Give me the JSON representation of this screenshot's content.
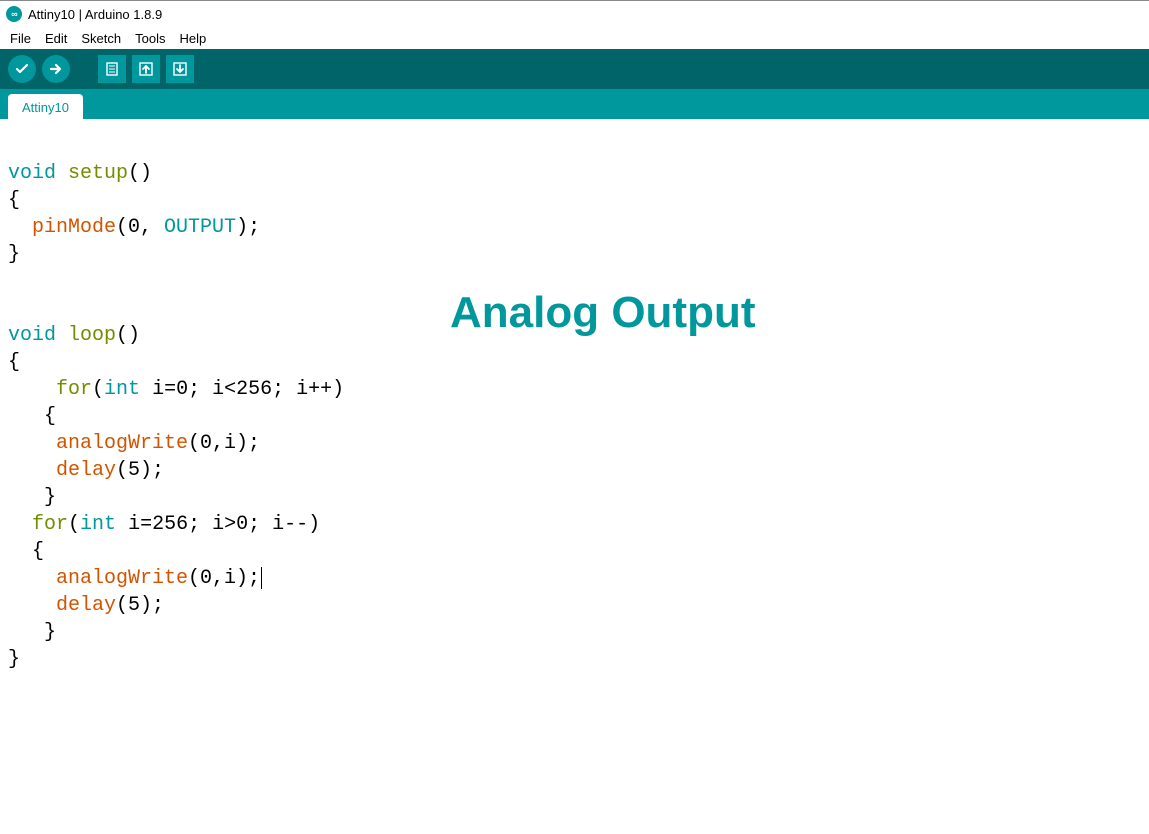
{
  "window": {
    "title": "Attiny10 | Arduino 1.8.9"
  },
  "menu": {
    "file": "File",
    "edit": "Edit",
    "sketch": "Sketch",
    "tools": "Tools",
    "help": "Help"
  },
  "tabs": {
    "active": "Attiny10"
  },
  "overlay": {
    "label": "Analog Output"
  },
  "code": {
    "l1_void": "void",
    "l1_setup": "setup",
    "l1_rest": "()",
    "l2": "{",
    "l3_fn": "pinMode",
    "l3_args_open": "(0, ",
    "l3_const": "OUTPUT",
    "l3_close": ");",
    "l4": "}",
    "l5": "",
    "l6": "",
    "l7_void": "void",
    "l7_loop": "loop",
    "l7_rest": "()",
    "l8": "{",
    "l9_for": "for",
    "l9_open": "(",
    "l9_int": "int",
    "l9_rest": " i=0; i<256; i++)",
    "l10": "   {",
    "l11_fn": "analogWrite",
    "l11_args": "(0,i);",
    "l12_fn": "delay",
    "l12_args": "(5);",
    "l13": "   }",
    "l14_for": "for",
    "l14_open": "(",
    "l14_int": "int",
    "l14_rest": " i=256; i>0; i--)",
    "l15": "  {",
    "l16_fn": "analogWrite",
    "l16_args": "(0,i);",
    "l17_fn": "delay",
    "l17_args": "(5);",
    "l18": "   }",
    "l19": "}"
  }
}
